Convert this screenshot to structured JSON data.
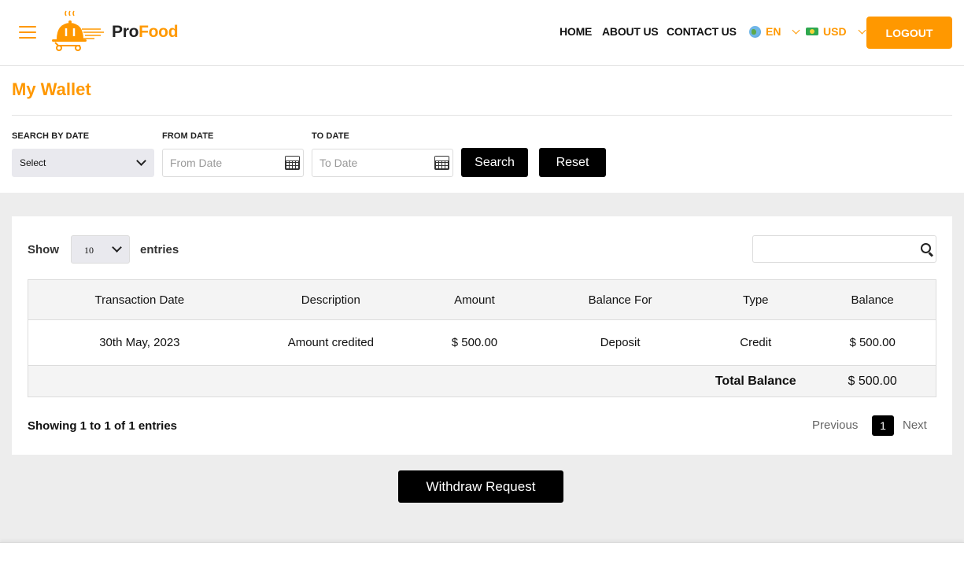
{
  "header": {
    "logo": {
      "part1": "Pro",
      "part2": "Food"
    },
    "nav": [
      "HOME",
      "ABOUT US",
      "CONTACT US"
    ],
    "language": {
      "icon": "globe-icon",
      "label": "EN"
    },
    "currency": {
      "icon": "cash-icon",
      "label": "USD"
    },
    "logout_label": "LOGOUT",
    "accent_color": "#ff9800"
  },
  "page": {
    "title": "My Wallet"
  },
  "filters": {
    "search_by_date": {
      "label": "SEARCH BY DATE",
      "value": "Select"
    },
    "from_date": {
      "label": "FROM DATE",
      "placeholder": "From Date",
      "value": ""
    },
    "to_date": {
      "label": "TO DATE",
      "placeholder": "To Date",
      "value": ""
    },
    "search_label": "Search",
    "reset_label": "Reset"
  },
  "table_controls": {
    "show_label": "Show",
    "page_size": "10",
    "entries_label": "entries",
    "search_value": ""
  },
  "table": {
    "columns": [
      "Transaction Date",
      "Description",
      "Amount",
      "Balance For",
      "Type",
      "Balance"
    ],
    "rows": [
      [
        "30th May, 2023",
        "Amount credited",
        "$ 500.00",
        "Deposit",
        "Credit",
        "$ 500.00"
      ]
    ],
    "total": {
      "label": "Total Balance",
      "value": "$ 500.00"
    }
  },
  "pagination": {
    "info": "Showing 1 to 1 of 1 entries",
    "previous": "Previous",
    "current_page": "1",
    "next": "Next"
  },
  "withdraw_label": "Withdraw Request"
}
